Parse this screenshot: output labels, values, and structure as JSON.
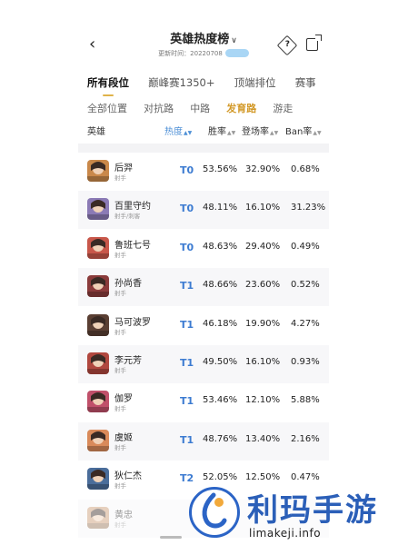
{
  "header": {
    "back_icon": "back-arrow-icon",
    "title": "英雄热度榜",
    "update_text": "更新时间：20220708",
    "pill_text": "",
    "icons": [
      "help-diamond-icon",
      "share-icon"
    ]
  },
  "tabs": [
    {
      "label": "所有段位",
      "active": true
    },
    {
      "label": "巅峰赛1350+",
      "active": false
    },
    {
      "label": "顶端排位",
      "active": false
    },
    {
      "label": "赛事",
      "active": false
    }
  ],
  "subtabs": [
    {
      "label": "全部位置",
      "active": false
    },
    {
      "label": "对抗路",
      "active": false
    },
    {
      "label": "中路",
      "active": false
    },
    {
      "label": "发育路",
      "active": true
    },
    {
      "label": "游走",
      "active": false
    }
  ],
  "columns": {
    "hero": "英雄",
    "heat": "热度",
    "win": "胜率",
    "pick": "登场率",
    "ban": "Ban率"
  },
  "rows": [
    {
      "name": "后羿",
      "role": "射手",
      "tier": "T0",
      "win": "53.56%",
      "pick": "32.90%",
      "ban": "0.68%",
      "color": "#c9884a"
    },
    {
      "name": "百里守约",
      "role": "射手/刺客",
      "tier": "T0",
      "win": "48.11%",
      "pick": "16.10%",
      "ban": "31.23%",
      "color": "#8b7ab5"
    },
    {
      "name": "鲁班七号",
      "role": "射手",
      "tier": "T0",
      "win": "48.63%",
      "pick": "29.40%",
      "ban": "0.49%",
      "color": "#c8574a"
    },
    {
      "name": "孙尚香",
      "role": "射手",
      "tier": "T1",
      "win": "48.66%",
      "pick": "23.60%",
      "ban": "0.52%",
      "color": "#8a3b3b"
    },
    {
      "name": "马可波罗",
      "role": "射手",
      "tier": "T1",
      "win": "46.18%",
      "pick": "19.90%",
      "ban": "4.27%",
      "color": "#5a3f33"
    },
    {
      "name": "李元芳",
      "role": "射手",
      "tier": "T1",
      "win": "49.50%",
      "pick": "16.10%",
      "ban": "0.93%",
      "color": "#b0473e"
    },
    {
      "name": "伽罗",
      "role": "射手",
      "tier": "T1",
      "win": "53.46%",
      "pick": "12.10%",
      "ban": "5.88%",
      "color": "#c0506a"
    },
    {
      "name": "虞姬",
      "role": "射手",
      "tier": "T1",
      "win": "48.76%",
      "pick": "13.40%",
      "ban": "2.16%",
      "color": "#d98a5a"
    },
    {
      "name": "狄仁杰",
      "role": "射手",
      "tier": "T2",
      "win": "52.05%",
      "pick": "12.50%",
      "ban": "0.47%",
      "color": "#4a6d9a"
    },
    {
      "name": "黄忠",
      "role": "射手",
      "tier": "",
      "win": "",
      "pick": "",
      "ban": "",
      "color": "#c89870"
    }
  ],
  "watermark": {
    "text": "利玛手游",
    "url": "limakeji.info",
    "color": "#2b5fb8"
  }
}
